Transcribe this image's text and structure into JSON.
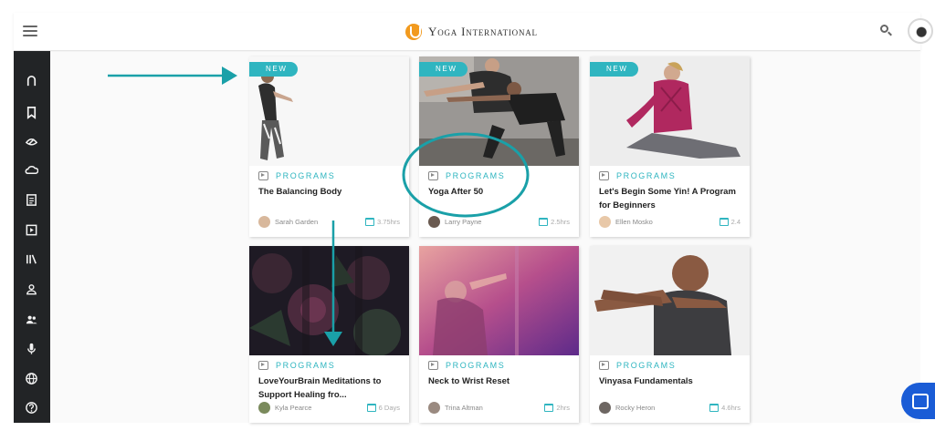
{
  "header": {
    "brand_name": "Yoga International",
    "menu_icon": "hamburger-icon",
    "search_icon": "search-icon"
  },
  "sidebar": {
    "icons": [
      "home-icon",
      "bookmark-icon",
      "lotus-icon",
      "cloud-icon",
      "article-icon",
      "video-icon",
      "library-icon",
      "person-icon",
      "group-icon",
      "microphone-icon",
      "globe-icon",
      "help-icon"
    ]
  },
  "cards": [
    {
      "badge": "NEW",
      "type": "PROGRAMS",
      "title": "The Balancing Body",
      "author": "Sarah Garden",
      "duration": "3.75hrs"
    },
    {
      "badge": "NEW",
      "type": "PROGRAMS",
      "title": "Yoga After 50",
      "author": "Larry Payne",
      "duration": "2.5hrs"
    },
    {
      "badge": "NEW",
      "type": "PROGRAMS",
      "title": "Let's Begin Some Yin! A Program for Beginners",
      "author": "Ellen Mosko",
      "duration": "2.4"
    },
    {
      "badge": "",
      "type": "PROGRAMS",
      "title": "LoveYourBrain Meditations to Support Healing fro...",
      "author": "Kyla Pearce",
      "duration": "6 Days"
    },
    {
      "badge": "",
      "type": "PROGRAMS",
      "title": "Neck to Wrist Reset",
      "author": "Trina Altman",
      "duration": "2hrs"
    },
    {
      "badge": "",
      "type": "PROGRAMS",
      "title": "Vinyasa Fundamentals",
      "author": "Rocky Heron",
      "duration": "4.6hrs"
    }
  ],
  "colors": {
    "accent": "#2fb5c0",
    "annotation": "#1aa0a8",
    "sidebar_bg": "#222426",
    "brand_orange": "#f29a1e",
    "chat_blue": "#1a5cd6"
  }
}
